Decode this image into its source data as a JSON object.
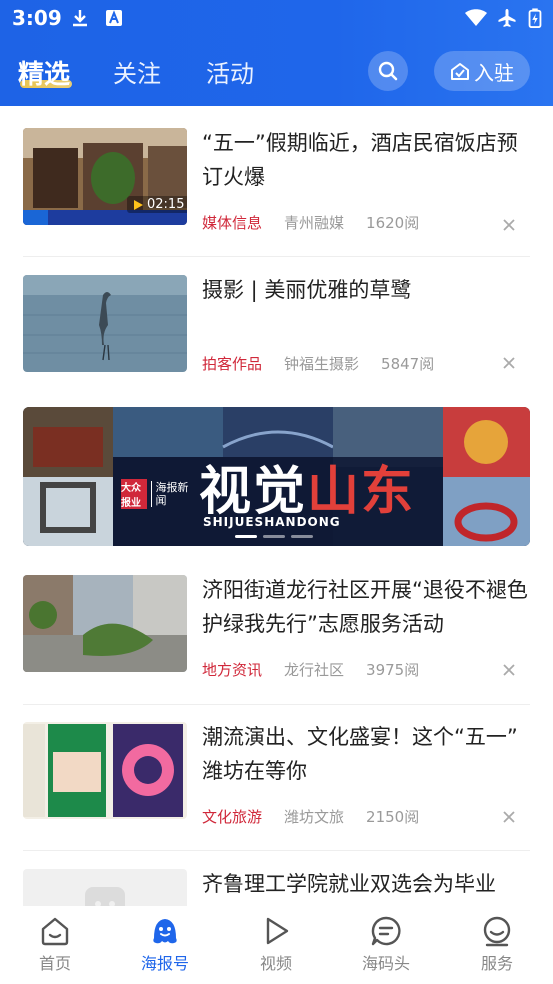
{
  "status_bar": {
    "time": "3:09"
  },
  "header": {
    "tabs": [
      {
        "label": "精选",
        "active": true
      },
      {
        "label": "关注",
        "active": false
      },
      {
        "label": "活动",
        "active": false
      }
    ],
    "join_label": "入驻",
    "search_icon": "search-icon"
  },
  "feed": {
    "items": [
      {
        "title": "“五一”假期临近，酒店民宿饭店预订火爆",
        "category": "媒体信息",
        "source": "青州融媒",
        "reads": "1620阅",
        "duration": "02:15"
      },
      {
        "title": "摄影 | 美丽优雅的草鹭",
        "category": "拍客作品",
        "source": "钟福生摄影",
        "reads": "5847阅"
      },
      {
        "title": "济阳街道龙行社区开展“退役不褪色 护绿我先行”志愿服务活动",
        "category": "地方资讯",
        "source": "龙行社区",
        "reads": "3975阅"
      },
      {
        "title": "潮流演出、文化盛宴！这个“五一” 潍坊在等你",
        "category": "文化旅游",
        "source": "潍坊文旅",
        "reads": "2150阅"
      },
      {
        "title": "齐鲁理工学院就业双选会为毕业"
      }
    ],
    "banner": {
      "title_part1": "视觉",
      "title_part2": "山东",
      "subtitle": "SHIJUESHANDONG",
      "logo_mark": "大众报业",
      "logo_text": "海报新闻"
    }
  },
  "bottom_nav": [
    {
      "label": "首页",
      "icon": "home-icon",
      "active": false
    },
    {
      "label": "海报号",
      "icon": "mascot-icon",
      "active": true
    },
    {
      "label": "视频",
      "icon": "play-icon",
      "active": false
    },
    {
      "label": "海码头",
      "icon": "chat-icon",
      "active": false
    },
    {
      "label": "服务",
      "icon": "smile-icon",
      "active": false
    }
  ],
  "colors": {
    "header_blue": "#1f66ea",
    "category_red": "#d0283a",
    "nav_active": "#1f66ea",
    "nav_inactive": "#888888"
  }
}
